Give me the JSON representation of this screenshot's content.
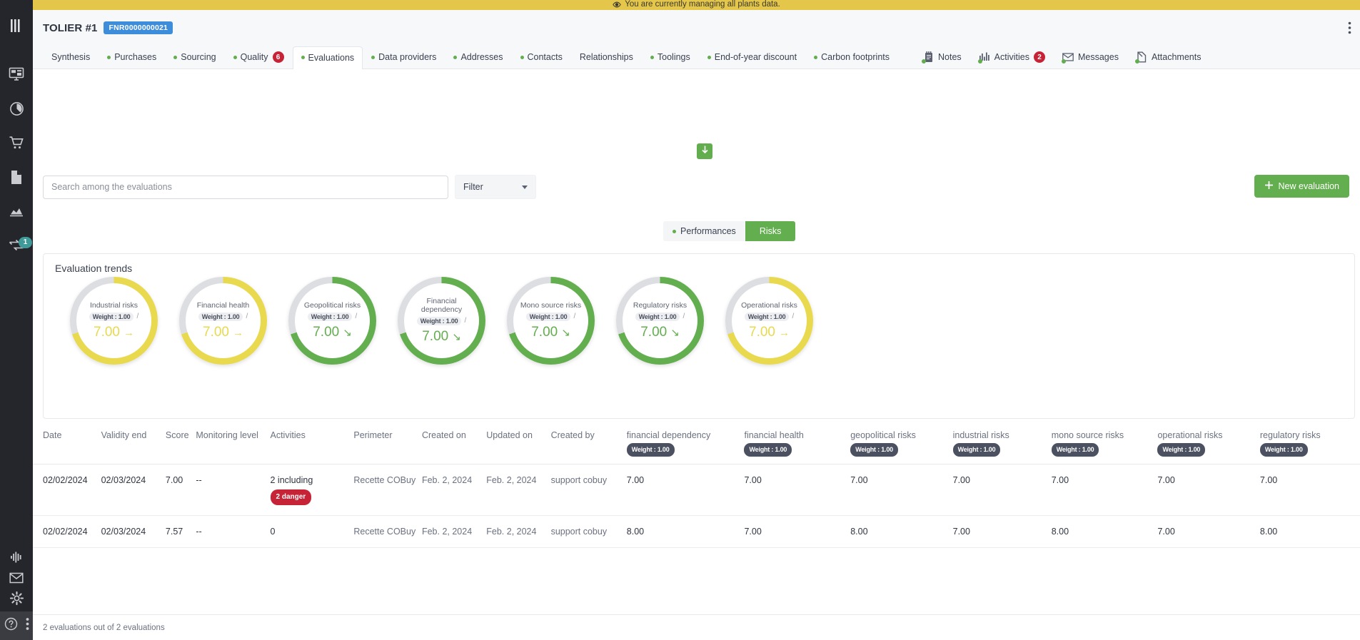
{
  "banner": {
    "text": "You are currently managing all plants data.",
    "icon": "eye-icon",
    "bg": "#e4c64b"
  },
  "header": {
    "title": "TOLIER #1",
    "reference": "FNR0000000021",
    "kebab_icon": "more-vertical-icon"
  },
  "rail": {
    "items": [
      {
        "name": "menu-toggle",
        "icon": "bars-icon"
      },
      {
        "name": "dashboard",
        "icon": "monitor-icon"
      },
      {
        "name": "performance",
        "icon": "gauge-icon"
      },
      {
        "name": "purchasing",
        "icon": "cart-icon"
      },
      {
        "name": "documents",
        "icon": "page-icon"
      },
      {
        "name": "analytics",
        "icon": "chart-icon"
      },
      {
        "name": "workflow",
        "icon": "transfer-icon",
        "badge": "1"
      }
    ],
    "bottom_items": [
      {
        "name": "activity",
        "icon": "waveform-icon"
      },
      {
        "name": "mail",
        "icon": "envelope-icon"
      },
      {
        "name": "settings",
        "icon": "gear-icon"
      }
    ],
    "foot_items": [
      {
        "name": "help",
        "icon": "question-circle-icon"
      },
      {
        "name": "overflow",
        "icon": "dots-vertical-icon"
      }
    ],
    "badge_color": "#3f9a99"
  },
  "tabs": [
    {
      "label": "Synthesis",
      "dot": false,
      "active": false
    },
    {
      "label": "Purchases",
      "dot": true,
      "active": false
    },
    {
      "label": "Sourcing",
      "dot": true,
      "active": false
    },
    {
      "label": "Quality",
      "dot": true,
      "active": false,
      "count": "6"
    },
    {
      "label": "Evaluations",
      "dot": true,
      "active": true
    },
    {
      "label": "Data providers",
      "dot": true,
      "active": false
    },
    {
      "label": "Addresses",
      "dot": true,
      "active": false
    },
    {
      "label": "Contacts",
      "dot": true,
      "active": false
    },
    {
      "label": "Relationships",
      "dot": false,
      "active": false
    },
    {
      "label": "Toolings",
      "dot": true,
      "active": false
    },
    {
      "label": "End-of-year discount",
      "dot": true,
      "active": false
    },
    {
      "label": "Carbon footprints",
      "dot": true,
      "active": false
    }
  ],
  "tabs_right": [
    {
      "label": "Notes",
      "icon": "notepad-icon",
      "dot": true
    },
    {
      "label": "Activities",
      "icon": "bars-chart-icon",
      "dot": true,
      "count": "2"
    },
    {
      "label": "Messages",
      "icon": "envelope-icon",
      "dot": true
    },
    {
      "label": "Attachments",
      "icon": "paperclip-page-icon",
      "dot": true
    }
  ],
  "toolbar": {
    "search_placeholder": "Search among the evaluations",
    "search_value": "",
    "filter_label": "Filter",
    "new_evaluation_label": "New evaluation",
    "collapse_icon": "arrow-down-icon"
  },
  "segments": {
    "performances_label": "Performances",
    "risks_label": "Risks",
    "active": "Risks"
  },
  "trends": {
    "title": "Evaluation trends",
    "gauges": [
      {
        "label": "Industrial risks",
        "weight": "Weight : 1.00",
        "score": "7.00",
        "trend": "flat",
        "color": "#e8d94f",
        "pct": 70
      },
      {
        "label": "Financial health",
        "weight": "Weight : 1.00",
        "score": "7.00",
        "trend": "flat",
        "color": "#e8d94f",
        "pct": 70
      },
      {
        "label": "Geopolitical risks",
        "weight": "Weight : 1.00",
        "score": "7.00",
        "trend": "down",
        "color": "#63ae4f",
        "pct": 70
      },
      {
        "label": "Financial dependency",
        "weight": "Weight : 1.00",
        "score": "7.00",
        "trend": "down",
        "color": "#63ae4f",
        "pct": 70
      },
      {
        "label": "Mono source risks",
        "weight": "Weight : 1.00",
        "score": "7.00",
        "trend": "down",
        "color": "#63ae4f",
        "pct": 70
      },
      {
        "label": "Regulatory risks",
        "weight": "Weight : 1.00",
        "score": "7.00",
        "trend": "down",
        "color": "#63ae4f",
        "pct": 70
      },
      {
        "label": "Operational risks",
        "weight": "Weight : 1.00",
        "score": "7.00",
        "trend": "flat",
        "color": "#e8d94f",
        "pct": 70
      }
    ]
  },
  "table": {
    "columns": [
      {
        "label": "Date",
        "weight": null
      },
      {
        "label": "Validity end",
        "weight": null
      },
      {
        "label": "Score",
        "weight": null
      },
      {
        "label": "Monitoring level",
        "weight": null
      },
      {
        "label": "Activities",
        "weight": null
      },
      {
        "label": "Perimeter",
        "weight": null
      },
      {
        "label": "Created on",
        "weight": null
      },
      {
        "label": "Updated on",
        "weight": null
      },
      {
        "label": "Created by",
        "weight": null
      },
      {
        "label": "financial dependency",
        "weight": "Weight : 1.00"
      },
      {
        "label": "financial health",
        "weight": "Weight : 1.00"
      },
      {
        "label": "geopolitical risks",
        "weight": "Weight : 1.00"
      },
      {
        "label": "industrial risks",
        "weight": "Weight : 1.00"
      },
      {
        "label": "mono source risks",
        "weight": "Weight : 1.00"
      },
      {
        "label": "operational risks",
        "weight": "Weight : 1.00"
      },
      {
        "label": "regulatory risks",
        "weight": "Weight : 1.00"
      }
    ],
    "settings_icon": "gear-icon",
    "rows": [
      {
        "date": "02/02/2024",
        "validity_end": "02/03/2024",
        "score": "7.00",
        "monitoring_level": "--",
        "activities": "2 including",
        "activities_badge": "2 danger",
        "perimeter": "Recette COBuy",
        "created_on": "Feb. 2, 2024",
        "updated_on": "Feb. 2, 2024",
        "created_by": "support cobuy",
        "financial_dependency": "7.00",
        "financial_health": "7.00",
        "geopolitical_risks": "7.00",
        "industrial_risks": "7.00",
        "mono_source_risks": "7.00",
        "operational_risks": "7.00",
        "regulatory_risks": "7.00"
      },
      {
        "date": "02/02/2024",
        "validity_end": "02/03/2024",
        "score": "7.57",
        "monitoring_level": "--",
        "activities": "0",
        "activities_badge": null,
        "perimeter": "Recette COBuy",
        "created_on": "Feb. 2, 2024",
        "updated_on": "Feb. 2, 2024",
        "created_by": "support cobuy",
        "financial_dependency": "8.00",
        "financial_health": "7.00",
        "geopolitical_risks": "8.00",
        "industrial_risks": "7.00",
        "mono_source_risks": "8.00",
        "operational_risks": "7.00",
        "regulatory_risks": "8.00"
      }
    ]
  },
  "footer": {
    "count_text": "2 evaluations out of 2 evaluations"
  },
  "colors": {
    "accent_green": "#63ae4f",
    "warning_yellow": "#e8d94f",
    "danger_red": "#c62337",
    "badge_blue": "#3d8ddb",
    "rail_dark": "#24262b"
  }
}
